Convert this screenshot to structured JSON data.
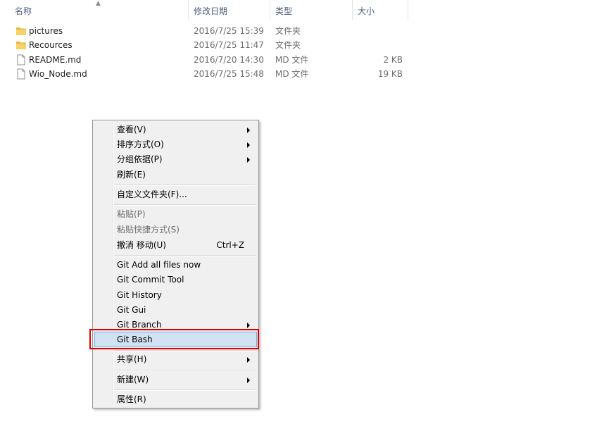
{
  "columns": {
    "name": "名称",
    "modified": "修改日期",
    "type": "类型",
    "size": "大小"
  },
  "files": [
    {
      "icon": "folder-icon",
      "name": "pictures",
      "modified": "2016/7/25 15:39",
      "type": "文件夹",
      "size": ""
    },
    {
      "icon": "folder-icon",
      "name": "Recources",
      "modified": "2016/7/25 11:47",
      "type": "文件夹",
      "size": ""
    },
    {
      "icon": "document-icon",
      "name": "README.md",
      "modified": "2016/7/20 14:30",
      "type": "MD 文件",
      "size": "2 KB"
    },
    {
      "icon": "document-icon",
      "name": "Wio_Node.md",
      "modified": "2016/7/25 15:48",
      "type": "MD 文件",
      "size": "19 KB"
    }
  ],
  "menu": {
    "view": "查看(V)",
    "sort": "排序方式(O)",
    "group": "分组依据(P)",
    "refresh": "刷新(E)",
    "customize": "自定义文件夹(F)...",
    "paste": "粘贴(P)",
    "paste_shortcut": "粘贴快捷方式(S)",
    "undo_move": "撤消 移动(U)",
    "undo_shortcut": "Ctrl+Z",
    "git_add_all": "Git Add all files now",
    "git_commit": "Git Commit Tool",
    "git_history": "Git History",
    "git_gui": "Git Gui",
    "git_branch": "Git Branch",
    "git_bash": "Git Bash",
    "share": "共享(H)",
    "new": "新建(W)",
    "properties": "属性(R)"
  },
  "colors": {
    "highlight": "#d1e2f2",
    "annotation": "#e00000",
    "folder": "#e8b93e"
  }
}
